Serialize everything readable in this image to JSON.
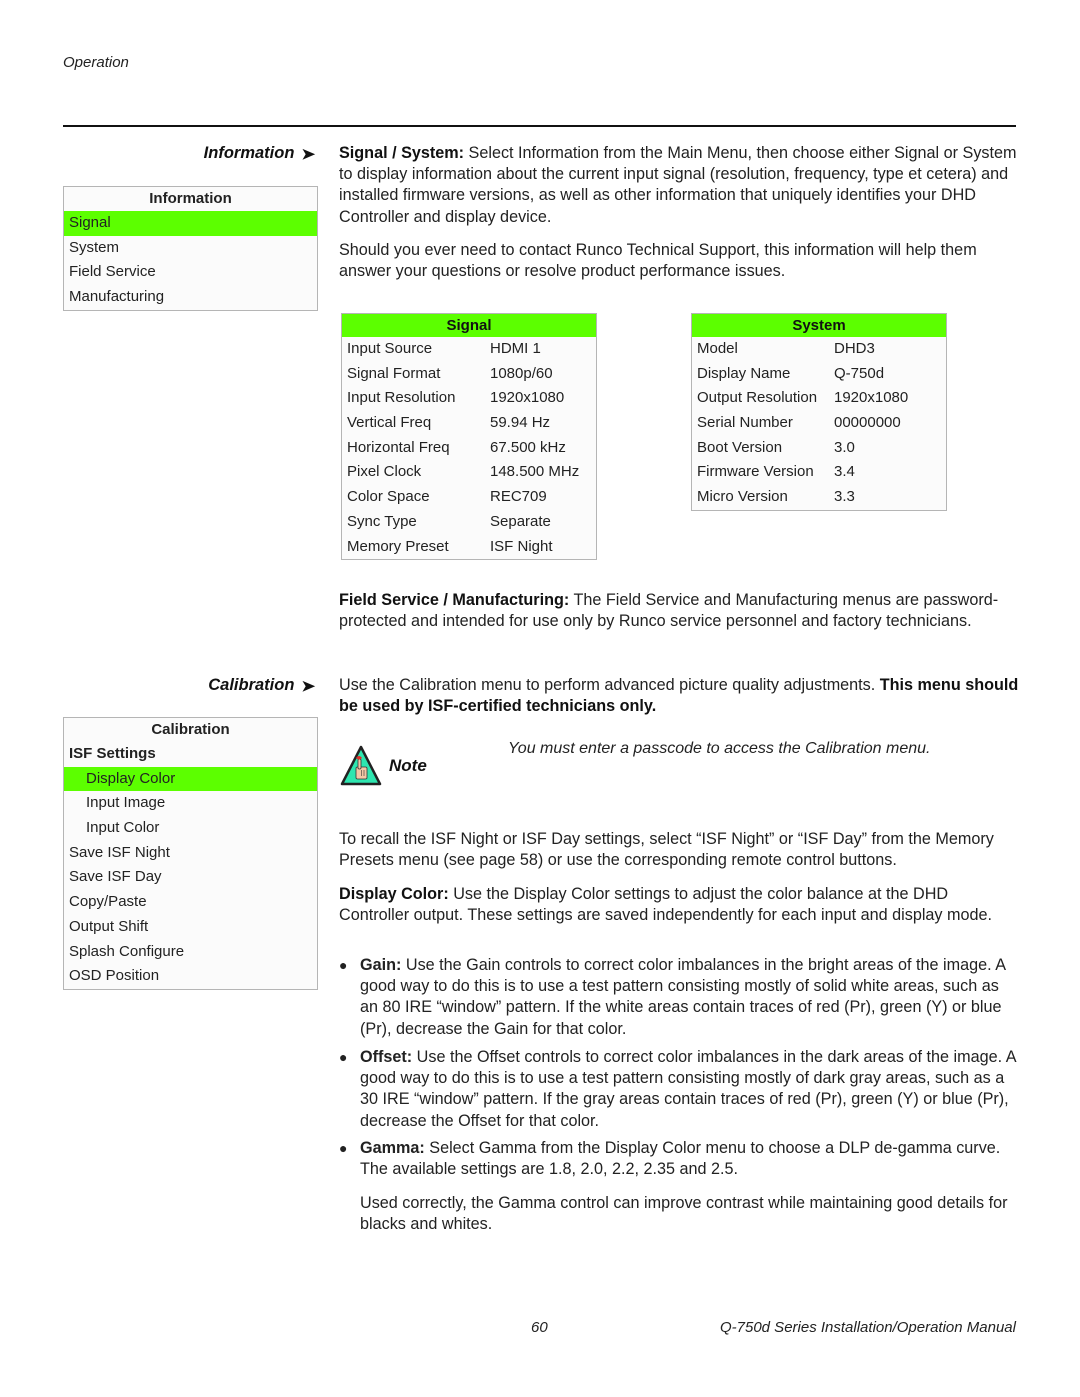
{
  "header": {
    "running_head": "Operation"
  },
  "sections": {
    "information": {
      "heading": "Information",
      "arrow": "➤",
      "menu": {
        "title": "Information",
        "items": [
          {
            "label": "Signal",
            "selected": true
          },
          {
            "label": "System",
            "selected": false
          },
          {
            "label": "Field Service",
            "selected": false
          },
          {
            "label": "Manufacturing",
            "selected": false
          }
        ]
      },
      "para1_lead": "Signal / System:",
      "para1_text": " Select Information from the Main Menu, then choose either Signal or System to display information about the current input signal (resolution, frequency, type et cetera) and installed firmware versions, as well as other information that uniquely identifies your DHD Controller and display device.",
      "para2_text": "Should you ever need to contact Runco Technical Support, this information will help them answer your questions or resolve product performance issues.",
      "signal_table": {
        "title": "Signal",
        "rows": [
          {
            "label": "Input Source",
            "value": "HDMI 1"
          },
          {
            "label": "Signal Format",
            "value": "1080p/60"
          },
          {
            "label": "Input Resolution",
            "value": "1920x1080"
          },
          {
            "label": "Vertical Freq",
            "value": "59.94 Hz"
          },
          {
            "label": "Horizontal Freq",
            "value": "67.500 kHz"
          },
          {
            "label": "Pixel Clock",
            "value": "148.500 MHz"
          },
          {
            "label": "Color Space",
            "value": "REC709"
          },
          {
            "label": "Sync Type",
            "value": "Separate"
          },
          {
            "label": "Memory Preset",
            "value": "ISF Night"
          }
        ]
      },
      "system_table": {
        "title": "System",
        "rows": [
          {
            "label": "Model",
            "value": "DHD3"
          },
          {
            "label": "Display Name",
            "value": "Q-750d"
          },
          {
            "label": "Output Resolution",
            "value": "1920x1080"
          },
          {
            "label": "Serial Number",
            "value": "00000000"
          },
          {
            "label": "Boot Version",
            "value": "3.0"
          },
          {
            "label": "Firmware Version",
            "value": "3.4"
          },
          {
            "label": "Micro Version",
            "value": "3.3"
          }
        ]
      },
      "para3_lead": "Field Service / Manufacturing:",
      "para3_text": " The Field Service and Manufacturing menus are password-protected and intended for use only by Runco service personnel and factory technicians."
    },
    "calibration": {
      "heading": "Calibration",
      "arrow": "➤",
      "menu": {
        "title": "Calibration",
        "items": [
          {
            "label": "ISF Settings",
            "type": "group"
          },
          {
            "label": "Display Color",
            "type": "sub",
            "selected": true
          },
          {
            "label": "Input Image",
            "type": "sub"
          },
          {
            "label": "Input Color",
            "type": "sub"
          },
          {
            "label": "Save ISF Night",
            "type": "item"
          },
          {
            "label": "Save ISF Day",
            "type": "item"
          },
          {
            "label": "Copy/Paste",
            "type": "item"
          },
          {
            "label": "Output Shift",
            "type": "item"
          },
          {
            "label": "Splash Configure",
            "type": "item"
          },
          {
            "label": "OSD Position",
            "type": "item"
          }
        ]
      },
      "intro_text": "Use the Calibration menu to perform advanced picture quality adjustments. ",
      "intro_bold": "This menu should be used by ISF-certified technicians only.",
      "note": {
        "icon": "note-hand-triangle-icon",
        "label": "Note",
        "text": "You must enter a passcode to access the Calibration menu."
      },
      "recall_text": "To recall the ISF Night or ISF Day settings, select “ISF Night” or “ISF Day” from the Memory Presets menu (see page 58) or use the corresponding remote control buttons.",
      "display_color_lead": "Display Color:",
      "display_color_text": " Use the Display Color settings to adjust the color balance at the DHD Controller output. These settings are saved independently for each input and display mode.",
      "bullets": [
        {
          "lead": "Gain:",
          "text": " Use the Gain controls to correct color imbalances in the bright areas of the image. A good way to do this is to use a test pattern consisting mostly of solid white areas, such as an 80 IRE “window” pattern. If the white areas contain traces of red (Pr), green (Y) or blue (Pr), decrease the Gain for that color."
        },
        {
          "lead": "Offset:",
          "text": " Use the Offset controls to correct color imbalances in the dark areas of the image. A good way to do this is to use a test pattern consisting mostly of dark gray areas, such as a 30 IRE “window” pattern. If the gray areas contain traces of red (Pr), green (Y) or blue (Pr), decrease the Offset for that color."
        },
        {
          "lead": "Gamma:",
          "text": " Select Gamma from the Display Color menu to choose a DLP de-gamma curve. The available settings are 1.8, 2.0, 2.2, 2.35 and 2.5."
        }
      ],
      "gamma_followup": "Used correctly, the Gamma control can improve contrast while maintaining good details for blacks and whites."
    }
  },
  "footer": {
    "page_number": "60",
    "manual_title": "Q-750d Series Installation/Operation Manual"
  },
  "colors": {
    "highlight": "#5cff00",
    "panel_border": "#b5b5b5",
    "note_icon_fill": "#2ee6b0"
  }
}
